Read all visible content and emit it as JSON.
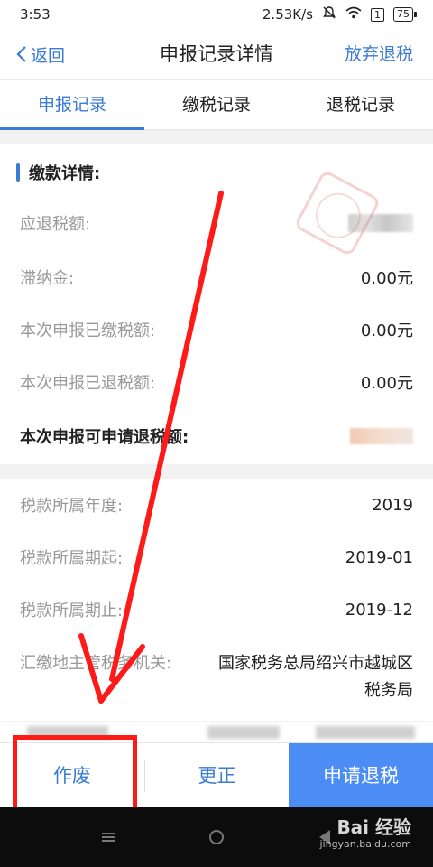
{
  "status_bar": {
    "time": "3:53",
    "speed": "2.53K/s",
    "sim": "1",
    "battery": "75"
  },
  "nav": {
    "back_label": "返回",
    "title": "申报记录详情",
    "action_label": "放弃退税"
  },
  "tabs": [
    {
      "label": "申报记录",
      "active": true
    },
    {
      "label": "缴税记录",
      "active": false
    },
    {
      "label": "退税记录",
      "active": false
    }
  ],
  "payment_details": {
    "section_title": "缴款详情:",
    "rows": [
      {
        "label": "应退税额:",
        "value": ""
      },
      {
        "label": "滞纳金:",
        "value": "0.00元"
      },
      {
        "label": "本次申报已缴税额:",
        "value": "0.00元"
      },
      {
        "label": "本次申报已退税额:",
        "value": "0.00元"
      },
      {
        "label": "本次申报可申请退税额:",
        "value": ""
      }
    ]
  },
  "tax_period": {
    "rows": [
      {
        "label": "税款所属年度:",
        "value": "2019"
      },
      {
        "label": "税款所属期起:",
        "value": "2019-01"
      },
      {
        "label": "税款所属期止:",
        "value": "2019-12"
      },
      {
        "label": "汇缴地主管税务机关:",
        "value": "国家税务总局绍兴市越城区税务局"
      }
    ]
  },
  "actions": {
    "void_label": "作废",
    "correct_label": "更正",
    "refund_label": "申请退税"
  },
  "watermark": {
    "main": "Bai 经验",
    "sub": "jingyan.baidu.com"
  },
  "colors": {
    "accent": "#3a7bd5",
    "primary_button": "#4b8cf5",
    "annotation": "#ff1a1a"
  }
}
